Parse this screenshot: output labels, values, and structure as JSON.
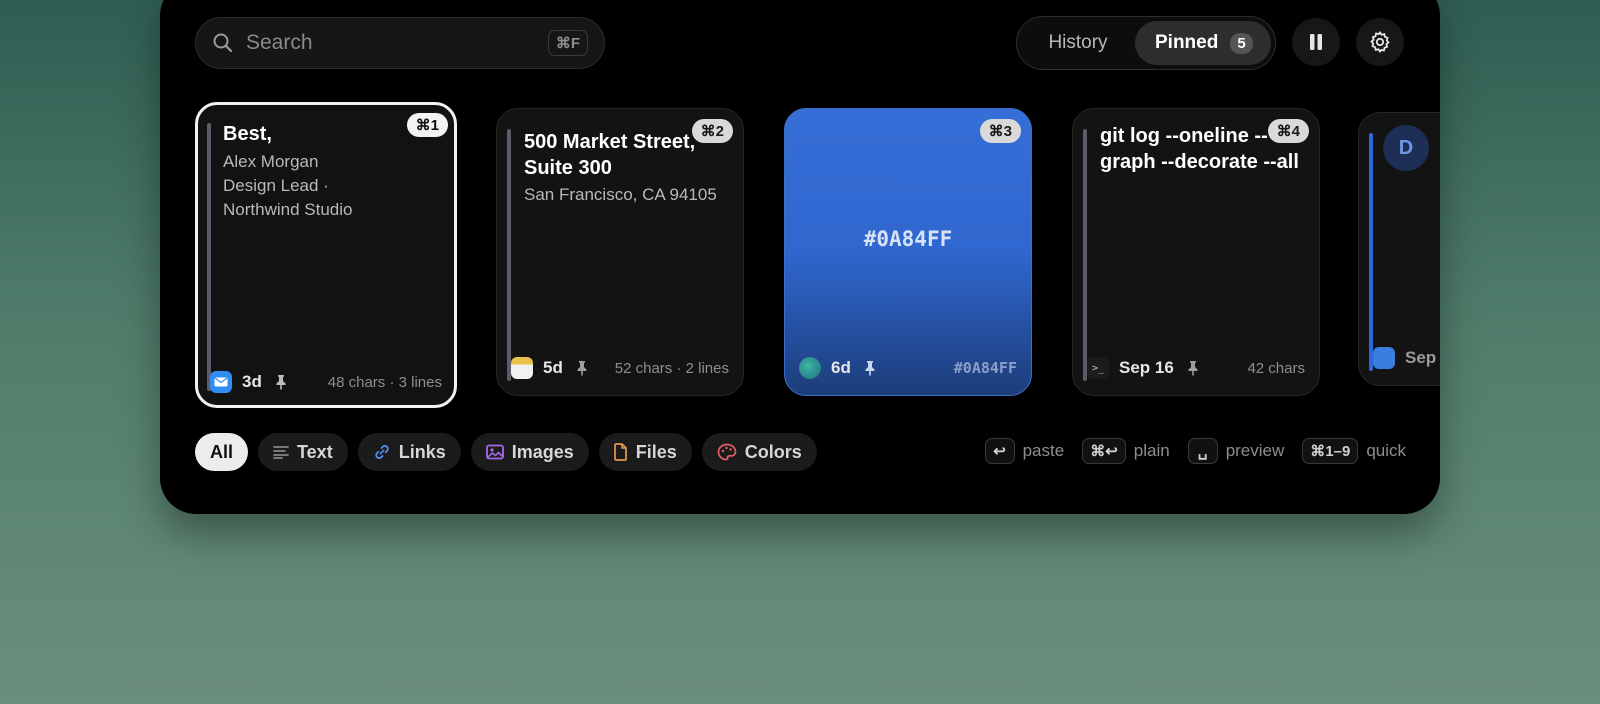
{
  "search": {
    "placeholder": "Search",
    "shortcut": "⌘F"
  },
  "tabs": {
    "history": "History",
    "pinned": "Pinned",
    "pinned_count": "5"
  },
  "cards": [
    {
      "shortcut": "⌘1",
      "title": "Best,",
      "lines": [
        "Alex Morgan",
        "Design Lead ·",
        "Northwind Studio"
      ],
      "age": "3d",
      "meta": "48 chars · 3 lines"
    },
    {
      "shortcut": "⌘2",
      "title": "500 Market Street, Suite 300",
      "lines": [
        "San Francisco, CA 94105"
      ],
      "age": "5d",
      "meta": "52 chars · 2 lines"
    },
    {
      "shortcut": "⌘3",
      "hex": "#0A84FF",
      "age": "6d",
      "meta": "#0A84FF"
    },
    {
      "shortcut": "⌘4",
      "title": "git log --oneline --graph --decorate --all",
      "age": "Sep 16",
      "meta": "42 chars"
    },
    {
      "avatar_letter": "D",
      "age": "Sep"
    }
  ],
  "filters": [
    "All",
    "Text",
    "Links",
    "Images",
    "Files",
    "Colors"
  ],
  "hints": [
    {
      "key": "↩",
      "label": "paste"
    },
    {
      "key": "⌘↩",
      "label": "plain"
    },
    {
      "key": "␣",
      "label": "preview"
    },
    {
      "key": "⌘1–9",
      "label": "quick"
    }
  ],
  "colors": {
    "accent_blue": "#0A84FF",
    "panel": "#000000"
  }
}
